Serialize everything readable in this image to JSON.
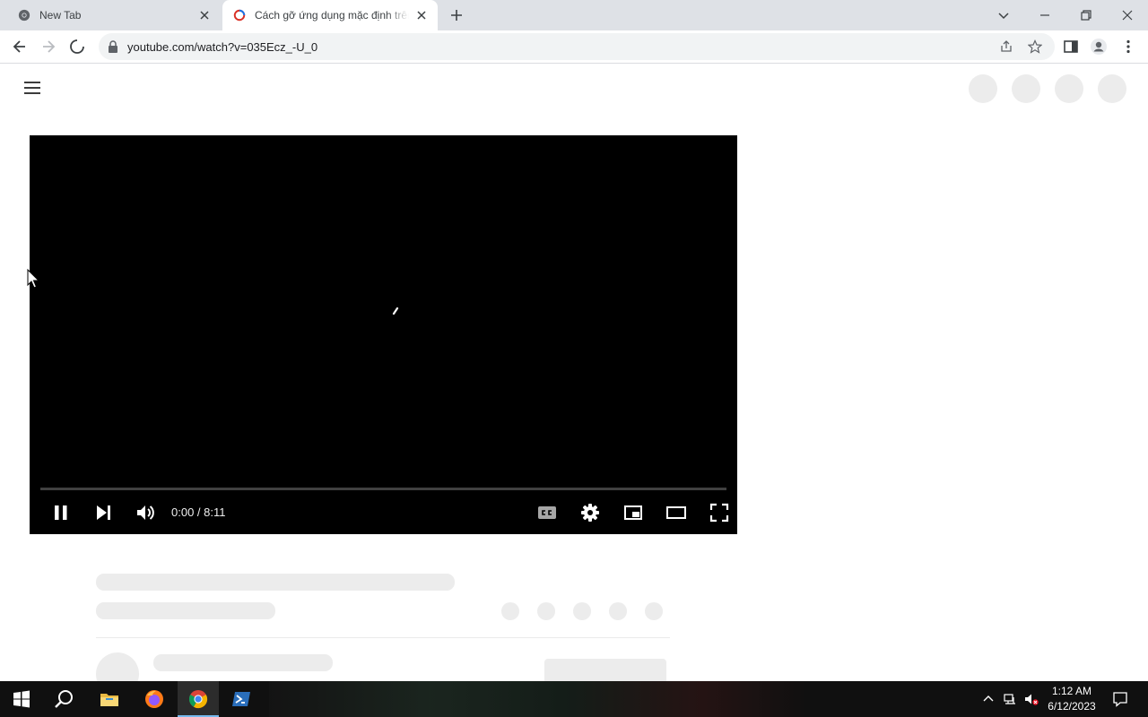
{
  "browser": {
    "tabs": [
      {
        "title": "New Tab",
        "active": false,
        "icon": "chrome-icon"
      },
      {
        "title": "Cách gỡ ứng dụng mặc định trên",
        "active": true,
        "icon": "youtube-loading-icon"
      }
    ],
    "address": {
      "url": "youtube.com/watch?v=035Ecz_-U_0"
    }
  },
  "player": {
    "time": "0:00 / 8:11",
    "progress_fraction": 0.0
  },
  "taskbar": {
    "clock_time": "1:12 AM",
    "clock_date": "6/12/2023"
  },
  "colors": {
    "accent": "#1a73e8",
    "tabstrip": "#dee1e6",
    "skeleton": "#ececec"
  }
}
